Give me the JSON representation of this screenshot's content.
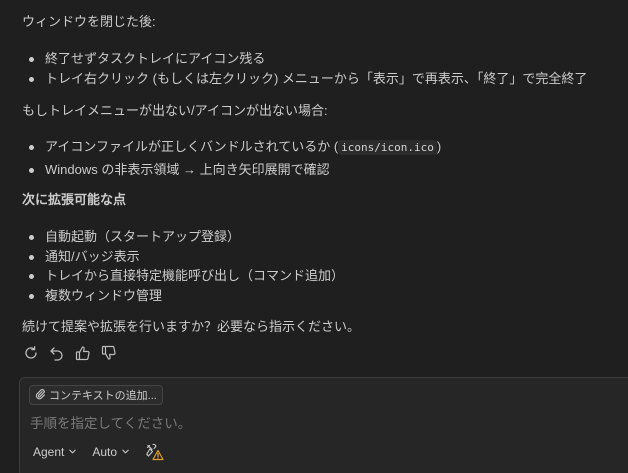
{
  "message": {
    "after_close_heading": "ウィンドウを閉じた後:",
    "after_close_items": [
      "終了せずタスクトレイにアイコン残る",
      "トレイ右クリック (もしくは左クリック) メニューから「表示」で再表示、「終了」で完全終了"
    ],
    "missing_heading": "もしトレイメニューが出ない/アイコンが出ない場合:",
    "missing_item1_text": "アイコンファイルが正しくバンドルされているか (",
    "missing_item1_code": "icons/icon.ico",
    "missing_item1_close": ")",
    "missing_item2": "Windows の非表示領域 → 上向き矢印展開で確認",
    "next_heading": "次に拡張可能な点",
    "next_items": [
      "自動起動（スタートアップ登録）",
      "通知/バッジ表示",
      "トレイから直接特定機能呼び出し（コマンド追加）",
      "複数ウィンドウ管理"
    ],
    "closing": "続けて提案や拡張を行いますか？必要なら指示ください。"
  },
  "actions": {
    "icons": [
      "retry-icon",
      "undo-icon",
      "thumbs-up-icon",
      "thumbs-down-icon"
    ]
  },
  "input": {
    "add_context_label": "コンテキストの追加...",
    "placeholder": "手順を指定してください。",
    "mode_label": "Agent",
    "model_label": "Auto",
    "tools_icon": "tools-warning-icon"
  }
}
